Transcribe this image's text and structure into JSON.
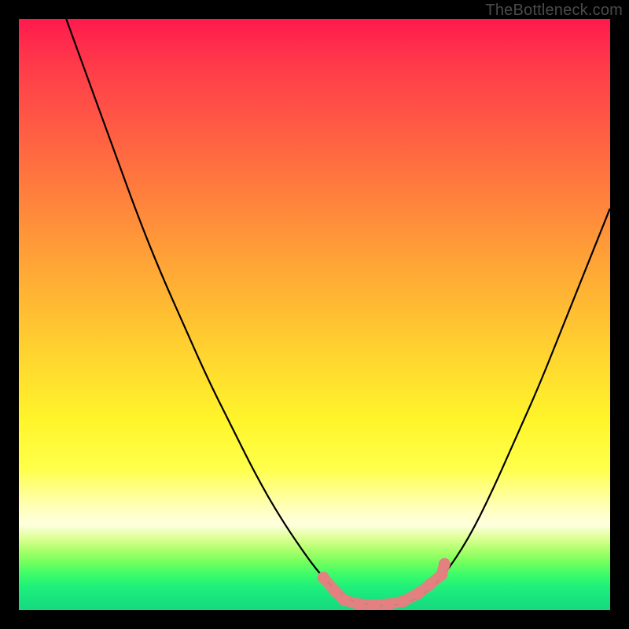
{
  "attribution": "TheBottleneck.com",
  "chart_data": {
    "type": "line",
    "title": "",
    "xlabel": "",
    "ylabel": "",
    "xlim": [
      0,
      100
    ],
    "ylim": [
      0,
      100
    ],
    "grid": false,
    "legend": false,
    "series": [
      {
        "name": "bottleneck-curve",
        "color": "#000000",
        "points": [
          {
            "x": 8,
            "y": 100
          },
          {
            "x": 12,
            "y": 89
          },
          {
            "x": 16,
            "y": 78
          },
          {
            "x": 20,
            "y": 67
          },
          {
            "x": 24,
            "y": 57
          },
          {
            "x": 28,
            "y": 48
          },
          {
            "x": 32,
            "y": 39
          },
          {
            "x": 36,
            "y": 31
          },
          {
            "x": 40,
            "y": 23
          },
          {
            "x": 44,
            "y": 16
          },
          {
            "x": 48,
            "y": 10
          },
          {
            "x": 51,
            "y": 6
          },
          {
            "x": 54,
            "y": 3
          },
          {
            "x": 57,
            "y": 1.2
          },
          {
            "x": 60,
            "y": 0.8
          },
          {
            "x": 63,
            "y": 0.8
          },
          {
            "x": 66,
            "y": 1.3
          },
          {
            "x": 69,
            "y": 3
          },
          {
            "x": 72,
            "y": 6
          },
          {
            "x": 76,
            "y": 12
          },
          {
            "x": 80,
            "y": 20
          },
          {
            "x": 84,
            "y": 29
          },
          {
            "x": 88,
            "y": 38
          },
          {
            "x": 92,
            "y": 48
          },
          {
            "x": 96,
            "y": 58
          },
          {
            "x": 100,
            "y": 68
          }
        ]
      }
    ],
    "markers": [
      {
        "name": "marker-valley",
        "color": "#e58080",
        "shape": "pill",
        "points": [
          {
            "x": 51.5,
            "y": 5.5
          },
          {
            "x": 53.5,
            "y": 3.2
          },
          {
            "x": 55.0,
            "y": 1.7
          },
          {
            "x": 57.5,
            "y": 1.0
          },
          {
            "x": 60.0,
            "y": 0.9
          },
          {
            "x": 62.5,
            "y": 1.0
          },
          {
            "x": 65.0,
            "y": 1.5
          },
          {
            "x": 67.5,
            "y": 2.8
          },
          {
            "x": 69.5,
            "y": 4.3
          },
          {
            "x": 71.5,
            "y": 6.0
          },
          {
            "x": 72.0,
            "y": 7.8
          }
        ]
      }
    ],
    "background_gradient": {
      "type": "vertical",
      "stops": [
        {
          "pos": 0.0,
          "color": "#ff1a4d"
        },
        {
          "pos": 0.5,
          "color": "#ffd82f"
        },
        {
          "pos": 0.82,
          "color": "#ffffb0"
        },
        {
          "pos": 0.9,
          "color": "#a8ff6a"
        },
        {
          "pos": 1.0,
          "color": "#17d97f"
        }
      ]
    }
  }
}
